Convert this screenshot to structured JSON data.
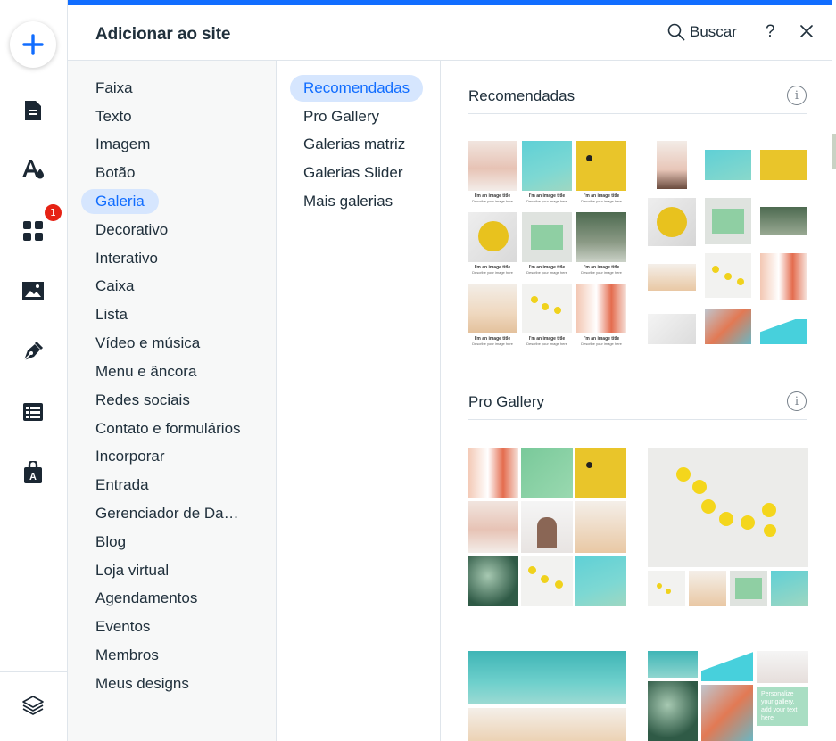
{
  "panel": {
    "title": "Adicionar ao site",
    "search_label": "Buscar",
    "help_label": "?"
  },
  "left_toolbar": {
    "items": [
      {
        "name": "add",
        "icon": "plus-icon"
      },
      {
        "name": "pages",
        "icon": "page-icon"
      },
      {
        "name": "design",
        "icon": "text-color-icon"
      },
      {
        "name": "apps",
        "icon": "grid-icon",
        "badge": "1"
      },
      {
        "name": "media",
        "icon": "image-icon"
      },
      {
        "name": "blog",
        "icon": "pen-icon"
      },
      {
        "name": "cms",
        "icon": "table-icon"
      },
      {
        "name": "market",
        "icon": "bag-icon"
      },
      {
        "name": "layers",
        "icon": "layers-icon"
      }
    ]
  },
  "categories": [
    "Faixa",
    "Texto",
    "Imagem",
    "Botão",
    "Galeria",
    "Decorativo",
    "Interativo",
    "Caixa",
    "Lista",
    "Vídeo e música",
    "Menu e âncora",
    "Redes sociais",
    "Contato e formulários",
    "Incorporar",
    "Entrada",
    "Gerenciador de Da…",
    "Blog",
    "Loja virtual",
    "Agendamentos",
    "Eventos",
    "Membros",
    "Meus designs"
  ],
  "selected_category": "Galeria",
  "subcategories": [
    "Recomendadas",
    "Pro Gallery",
    "Galerias matriz",
    "Galerias Slider",
    "Mais galerias"
  ],
  "selected_subcategory": "Recomendadas",
  "sections": [
    {
      "title": "Recomendadas",
      "info": "i"
    },
    {
      "title": "Pro Gallery",
      "info": "i"
    }
  ],
  "gallery_captions": {
    "title": "I'm an image title",
    "subtitle": "Describe your image here"
  },
  "promo_text": "Personalize your gallery, add your text here",
  "colors": {
    "accent": "#116dff",
    "selected_bg": "#d6e6fe",
    "badge": "#e62214",
    "sidebar_bg": "#f7f8f8"
  }
}
